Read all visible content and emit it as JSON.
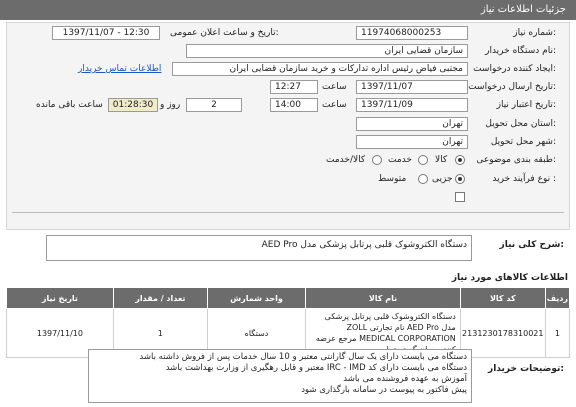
{
  "header": {
    "title": "جزئیات اطلاعات نیاز"
  },
  "form": {
    "need_number_label": "شماره نیاز:",
    "need_number": "11974068000253",
    "announce_label": "تاریخ و ساعت اعلان عمومی:",
    "announce_value": "1397/11/07 - 12:30",
    "buyer_label": "نام دستگاه خریدار:",
    "buyer": "سازمان قضایی ایران",
    "creator_label": "ایجاد کننده درخواست:",
    "creator": "مجتبی  فیاض رئیس اداره تدارکات و خرید سازمان قضایی ایران",
    "contact_link": "اطلاعات تماس خریدار",
    "send_date_label": "تاریخ ارسال درخواست:",
    "send_date": "1397/11/07",
    "send_time_label": "ساعت",
    "send_time": "12:27",
    "deadline_label": "تاریخ اعتبار نیاز:",
    "deadline_date": "1397/11/09",
    "deadline_time_label": "ساعت",
    "deadline_time": "14:00",
    "days": "2",
    "days_label": "روز و",
    "remaining": "01:28:30",
    "remaining_label": "ساعت باقی مانده",
    "province_label": "استان محل تحویل:",
    "province": "تهران",
    "city_label": "شهر محل تحویل:",
    "city": "تهران",
    "category_label": "طبقه بندی موضوعی:",
    "category_options": [
      "کالا",
      "خدمت",
      "کالا/خدمت"
    ],
    "process_label": "نوع فرآیند خرید :",
    "process_options": [
      "جزیی",
      "متوسط"
    ]
  },
  "general": {
    "label": "شرح کلی نیاز:",
    "value": "دستگاه الکتروشوک قلبی پرتابل پزشکی مدل AED Pro"
  },
  "items": {
    "title": "اطلاعات کالاهای مورد نیاز",
    "headers": [
      "ردیف",
      "کد کالا",
      "نام کالا",
      "واحد شمارش",
      "تعداد / مقدار",
      "تاریخ نیاز"
    ],
    "rows": [
      {
        "row": "1",
        "code": "2131230178310021",
        "name": "دستگاه الکتروشوک قلبی پرتابل پزشکی مدل AED Pro نام تجارتی ZOLL MEDICAL CORPORATION مرجع عرضه کننده جهان گستر تجارت",
        "unit": "دستگاه",
        "qty": "1",
        "date": "1397/11/10"
      }
    ]
  },
  "buyer_notes": {
    "label": "توضیحات خریدار:",
    "lines": [
      "دستگاه می بایست دارای یک سال گارانتی معتبر و 10 سال خدمات پس از فروش داشته باشد",
      "دستگاه می بایست دارای کد IRC - IMD معتبر و قابل رهگیری از وزارت بهداشت باشد",
      "آموزش به عهده فروشنده می باشد",
      "پیش فاکتور به پیوست در سامانه بارگذاری شود"
    ]
  },
  "colors": {
    "header_bg": "#6c6c6c",
    "timer_bg": "#f0ebc8",
    "link": "#1a56c4"
  }
}
